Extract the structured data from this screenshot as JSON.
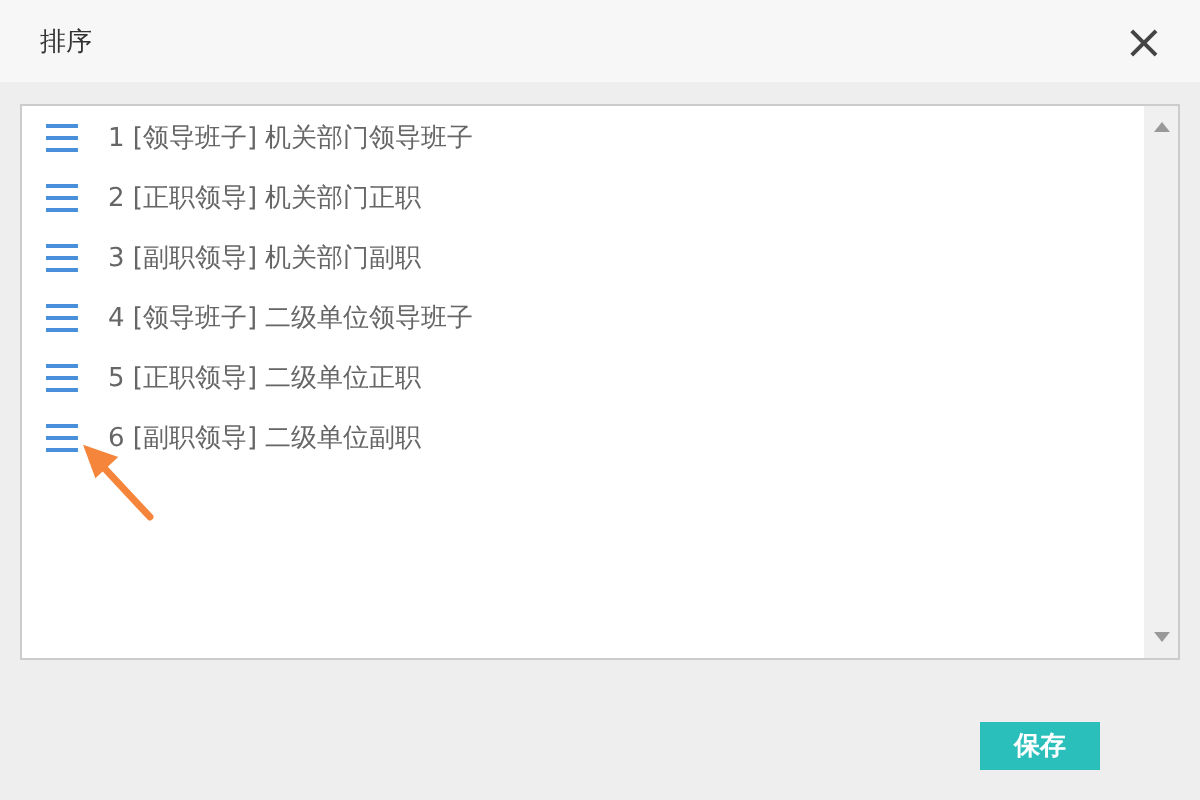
{
  "dialog": {
    "title": "排序",
    "close": "×"
  },
  "items": [
    {
      "label": "1 [领导班子] 机关部门领导班子"
    },
    {
      "label": "2 [正职领导] 机关部门正职"
    },
    {
      "label": "3 [副职领导] 机关部门副职"
    },
    {
      "label": "4 [领导班子] 二级单位领导班子"
    },
    {
      "label": "5 [正职领导] 二级单位正职"
    },
    {
      "label": "6 [副职领导] 二级单位副职"
    }
  ],
  "buttons": [
    "保存"
  ]
}
